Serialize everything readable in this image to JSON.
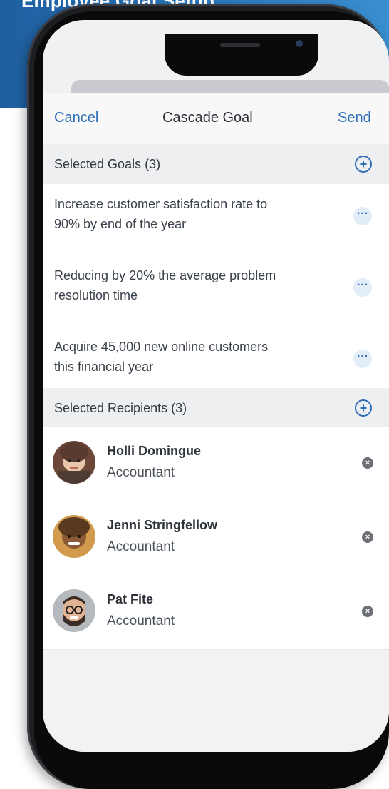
{
  "banner": {
    "headline": "Employee Goal Setup"
  },
  "header": {
    "cancel": "Cancel",
    "title": "Cascade Goal",
    "send": "Send"
  },
  "goals_section": {
    "title": "Selected Goals (3)",
    "add_icon": "plus-circle-icon",
    "items": [
      {
        "text": "Increase customer satisfaction rate to\n90% by end of the year"
      },
      {
        "text": "Reducing by 20% the average problem\nresolution time"
      },
      {
        "text": "Acquire 45,000 new online customers\n this financial year"
      }
    ],
    "more_icon": "more-horizontal-icon"
  },
  "recipients_section": {
    "title": "Selected Recipients (3)",
    "add_icon": "plus-circle-icon",
    "items": [
      {
        "name": "Holli Domingue",
        "role": "Accountant"
      },
      {
        "name": "Jenni Stringfellow",
        "role": "Accountant"
      },
      {
        "name": "Pat Fite",
        "role": "Accountant"
      }
    ],
    "remove_icon": "remove-x-icon"
  },
  "colors": {
    "accent": "#2e6fb7",
    "banner_start": "#1f5fa0",
    "banner_end": "#3a8fd0",
    "phone_frame": "#1d1e21"
  }
}
